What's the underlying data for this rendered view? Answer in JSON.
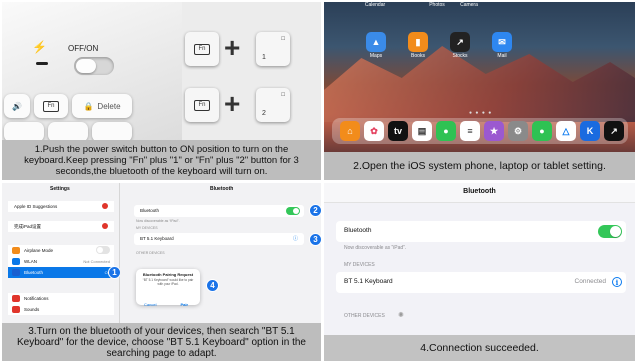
{
  "panels": [
    {
      "caption": "1.Push the power switch button to ON position to turn on the keyboard.Keep pressing \"Fn\" plus \"1\" or \"Fn\" plus \"2\" button for 3 seconds,the bluetooth of the keyboard will turn on.",
      "switch_label": "OFF/ON",
      "keys": {
        "fn": "Fn",
        "delete": "Delete",
        "num1": "1",
        "num2": "2"
      }
    },
    {
      "caption": "2.Open the iOS system phone, laptop or tablet setting.",
      "status_app_labels": [
        "Calendar",
        "Photos",
        "Camera"
      ],
      "app_labels": [
        "Maps",
        "Books",
        "Stocks",
        "Mail"
      ]
    },
    {
      "caption": "3.Turn on the bluetooth of your devices, then search \"BT 5.1 Keyboard\" for the device, choose \"BT 5.1 Keyboard\" option in the searching page to adapt.",
      "sidebar_title": "Settings",
      "main_title": "Bluetooth",
      "sidebar_rows": [
        {
          "label": "Apple ID Suggestions"
        },
        {
          "label": "完成iPad设置"
        },
        {
          "label": "Airplane Mode"
        },
        {
          "label": "WLAN",
          "value": "Not Connected"
        },
        {
          "label": "Bluetooth",
          "value": "On"
        },
        {
          "label": "Notifications"
        },
        {
          "label": "Sounds"
        }
      ],
      "main": {
        "bluetooth_label": "Bluetooth",
        "discoverable": "Now discoverable as “iPad”.",
        "my_devices": "MY DEVICES",
        "device_name": "BT 5.1 Keyboard",
        "other_devices": "OTHER DEVICES"
      },
      "dialog": {
        "title": "Bluetooth Pairing Request",
        "body": "“BT 5.1 Keyboard” would like to pair with your iPad.",
        "cancel": "Cancel",
        "pair": "Pair"
      },
      "badges": [
        "1",
        "2",
        "3",
        "4"
      ]
    },
    {
      "caption": "4.Connection succeeded.",
      "title": "Bluetooth",
      "bluetooth_label": "Bluetooth",
      "discoverable": "Now discoverable as “iPad”.",
      "my_devices": "MY DEVICES",
      "device_name": "BT 5.1 Keyboard",
      "device_status": "Connected",
      "other_devices": "OTHER DEVICES"
    }
  ],
  "colors": {
    "accent_blue": "#1a73e8",
    "toggle_green": "#34c759",
    "caption_bar": "#bdbdbd"
  }
}
